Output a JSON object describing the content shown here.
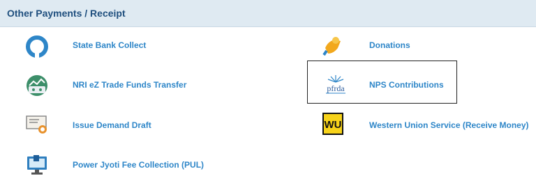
{
  "panel": {
    "title": "Other Payments / Receipt"
  },
  "left_items": [
    {
      "label": "State Bank Collect",
      "icon": "sbi-logo-icon"
    },
    {
      "label": "NRI eZ Trade Funds Transfer",
      "icon": "nri-trade-icon"
    },
    {
      "label": "Issue Demand Draft",
      "icon": "demand-draft-icon"
    },
    {
      "label": "Power Jyoti Fee Collection (PUL)",
      "icon": "computer-monitor-icon"
    }
  ],
  "right_items": [
    {
      "label": "Donations",
      "icon": "donation-hand-icon"
    },
    {
      "label": "NPS Contributions",
      "icon": "pfrda-logo-icon",
      "selected": true
    },
    {
      "label": "Western Union Service (Receive Money)",
      "icon": "western-union-logo-icon"
    }
  ],
  "colors": {
    "header_bg": "#dfeaf2",
    "title": "#1f4f7e",
    "link": "#2e86c8"
  }
}
